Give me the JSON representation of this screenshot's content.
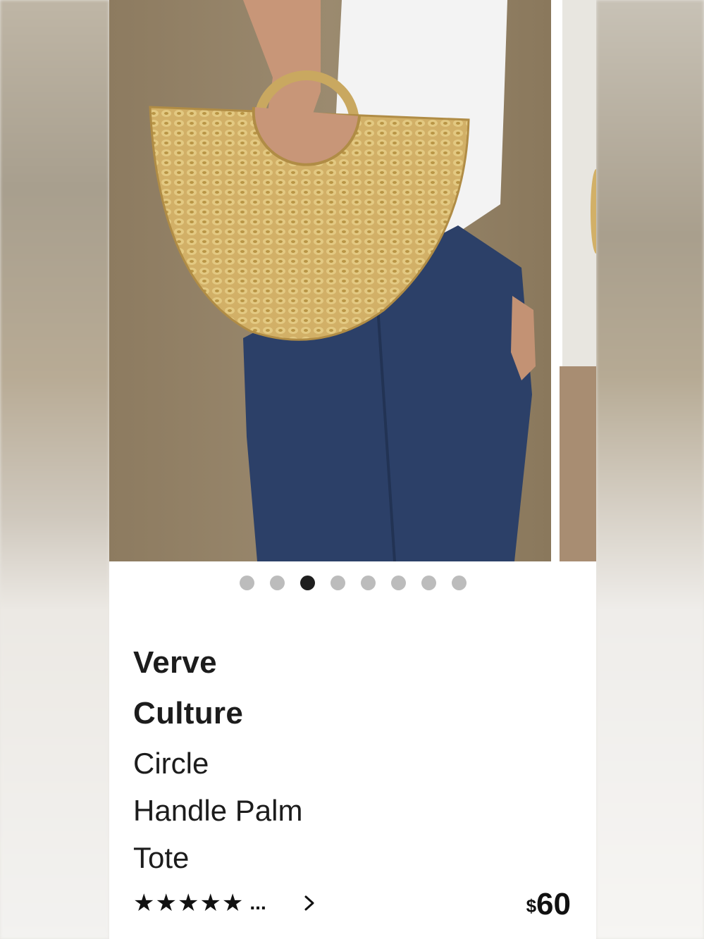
{
  "carousel": {
    "image_count": 8,
    "active_index": 2
  },
  "product": {
    "brand_line1": "Verve",
    "brand_line2": "Culture",
    "name_line1": "Circle",
    "name_line2": "Handle Palm",
    "name_line3": "Tote",
    "rating_stars": "★★★★★",
    "rating_rest": "...",
    "price_currency": "$",
    "price_amount": "60"
  },
  "colors": {
    "dot_inactive": "#bcbcbc",
    "dot_active": "#1e1e1e",
    "text": "#1c1c1c"
  },
  "icons": {
    "details": "chevron-right-icon",
    "rating": "star-icon"
  }
}
